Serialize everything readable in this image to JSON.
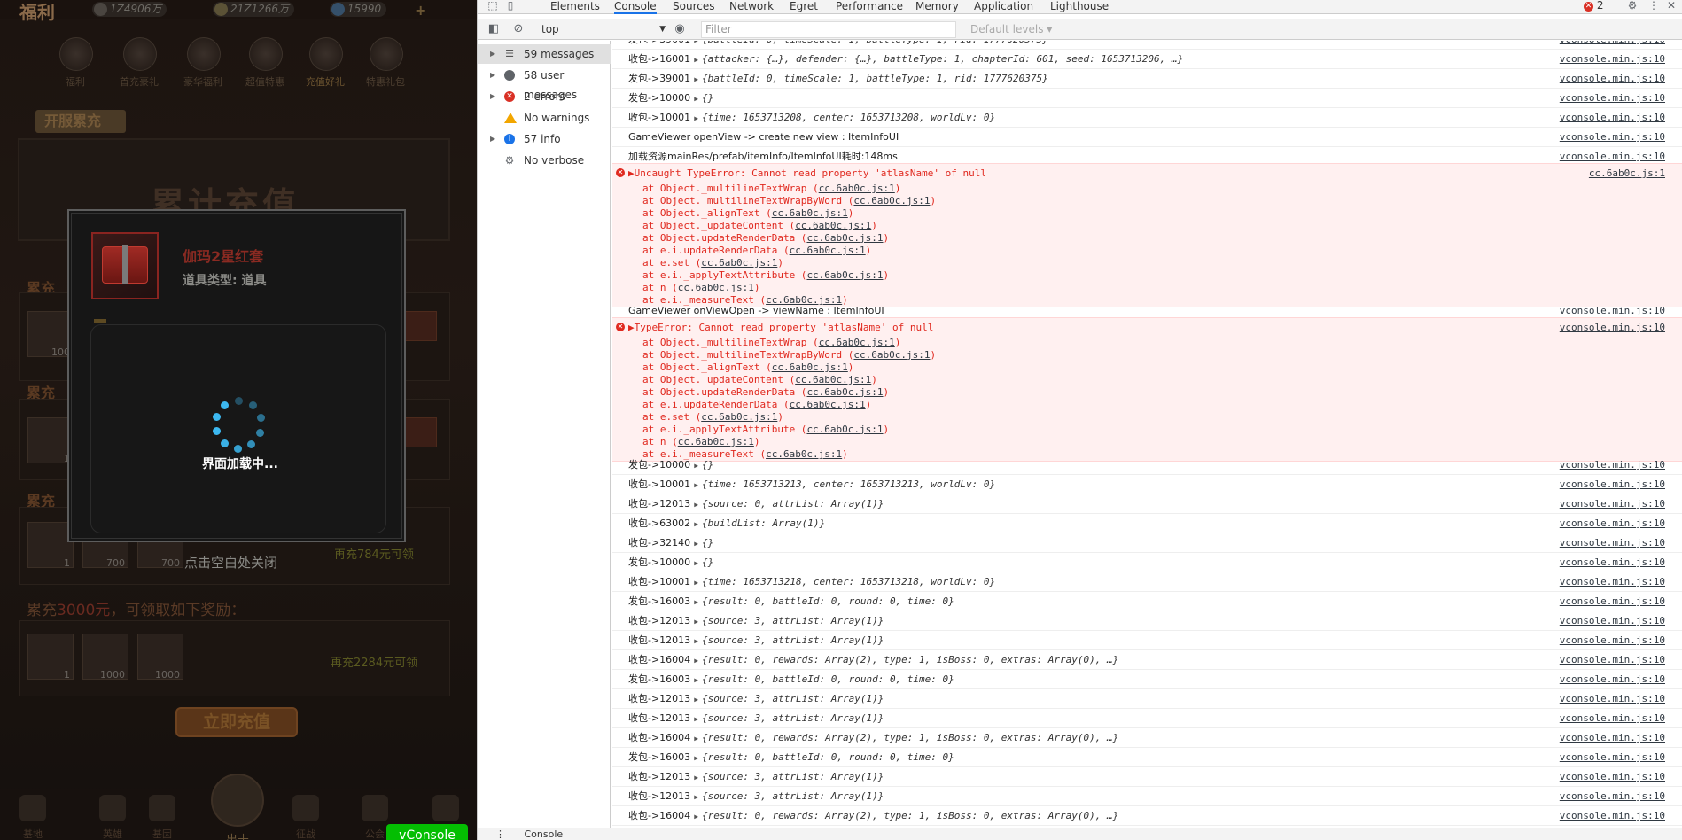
{
  "game": {
    "title": "福利",
    "resources": {
      "exp": "1Z4906万",
      "exp_label": "EXP",
      "gold": "21Z1266万",
      "gem": "15990",
      "plus": "+"
    },
    "icons": [
      {
        "label": "福利",
        "name": "welfare"
      },
      {
        "label": "首充豪礼",
        "name": "first-charge"
      },
      {
        "label": "豪华福利",
        "name": "luxury"
      },
      {
        "label": "超值特惠",
        "name": "deal"
      },
      {
        "label": "充值好礼",
        "name": "recharge-gift"
      },
      {
        "label": "特惠礼包",
        "name": "special-pack"
      }
    ],
    "banner_tag": "开服累充",
    "banner_title": "累计充值",
    "side_labels": [
      "累充",
      "累充",
      "累充",
      "累充"
    ],
    "row_text_prefix": "累充",
    "row_text_amount": "3000元",
    "row_text_suffix": "，可领取如下奖励：",
    "slot_counts": [
      "100",
      "1",
      "700",
      "700",
      "1",
      "1000",
      "1000"
    ],
    "hint_1": "再充784元可领",
    "hint_2": "再充2284元可领",
    "claim_button": "立即充值",
    "tap_close": "点击空白处关闭",
    "bottom_nav": [
      "基地",
      "英雄",
      "基因",
      "出击",
      "征战",
      "公会",
      "商城"
    ],
    "vconsole": "vConsole",
    "popup": {
      "item_name": "伽玛2星红套",
      "item_type": "道具类型:  道具",
      "loading": "界面加载中..."
    }
  },
  "devtools": {
    "tabs": [
      "Elements",
      "Console",
      "Sources",
      "Network",
      "Egret",
      "Performance",
      "Memory",
      "Application",
      "Lighthouse"
    ],
    "active_tab": "Console",
    "error_count": "2",
    "context": "top",
    "filter_placeholder": "Filter",
    "levels": "Default levels",
    "sidebar": [
      {
        "label": "59 messages",
        "icon": "list-icon",
        "kind": "list"
      },
      {
        "label": "58 user messages",
        "icon": "user-icon",
        "kind": "user"
      },
      {
        "label": "2 errors",
        "icon": "error-icon",
        "kind": "err"
      },
      {
        "label": "No warnings",
        "icon": "warning-icon",
        "kind": "warn"
      },
      {
        "label": "57 info",
        "icon": "info-icon",
        "kind": "info"
      },
      {
        "label": "No verbose",
        "icon": "verbose-icon",
        "kind": "verb"
      }
    ],
    "src_vconsole": "vconsole.min.js:10",
    "src_cc": "cc.6ab0c.js:1",
    "logs": [
      {
        "pre": "发包->39001",
        "obj": "{battleId: 0, timeScale: 1, battleType: 1, rid: 1777620375}"
      },
      {
        "pre": "收包->16001",
        "obj": "{attacker: {…}, defender: {…}, battleType: 1, chapterId: 601, seed: 1653713206, …}"
      },
      {
        "pre": "发包->39001",
        "obj": "{battleId: 0, timeScale: 1, battleType: 1, rid: 1777620375}"
      },
      {
        "pre": "发包->10000",
        "obj": "{}"
      },
      {
        "pre": "收包->10001",
        "obj": "{time: 1653713208, center: 1653713208, worldLv: 0}"
      },
      {
        "pre": "GameViewer openView -> create new view : ItemInfoUI",
        "obj": ""
      },
      {
        "pre": "加载资源mainRes/prefab/itemInfo/ItemInfoUI耗时:148ms",
        "obj": ""
      }
    ],
    "error1": {
      "head": "Uncaught TypeError: Cannot read property 'atlasName' of null",
      "src": "cc.6ab0c.js:1"
    },
    "mid_log": "GameViewer onViewOpen -> viewName : ItemInfoUI",
    "error2": {
      "head": "TypeError: Cannot read property 'atlasName' of null",
      "src": "vconsole.min.js:10"
    },
    "stack": [
      "at Object._multilineTextWrap",
      "at Object._multilineTextWrapByWord",
      "at Object._alignText",
      "at Object._updateContent",
      "at Object.updateRenderData",
      "at e.i.updateRenderData",
      "at e.set",
      "at e.i._applyTextAttribute",
      "at n",
      "at e.i._measureText"
    ],
    "logs2": [
      {
        "pre": "发包->10000",
        "obj": "{}"
      },
      {
        "pre": "收包->10001",
        "obj": "{time: 1653713213, center: 1653713213, worldLv: 0}"
      },
      {
        "pre": "收包->12013",
        "obj": "{source: 0, attrList: Array(1)}"
      },
      {
        "pre": "收包->63002",
        "obj": "{buildList: Array(1)}"
      },
      {
        "pre": "收包->32140",
        "obj": "{}"
      },
      {
        "pre": "发包->10000",
        "obj": "{}"
      },
      {
        "pre": "收包->10001",
        "obj": "{time: 1653713218, center: 1653713218, worldLv: 0}"
      },
      {
        "pre": "发包->16003",
        "obj": "{result: 0, battleId: 0, round: 0, time: 0}"
      },
      {
        "pre": "收包->12013",
        "obj": "{source: 3, attrList: Array(1)}"
      },
      {
        "pre": "收包->12013",
        "obj": "{source: 3, attrList: Array(1)}"
      },
      {
        "pre": "收包->16004",
        "obj": "{result: 0, rewards: Array(2), type: 1, isBoss: 0, extras: Array(0), …}"
      },
      {
        "pre": "发包->16003",
        "obj": "{result: 0, battleId: 0, round: 0, time: 0}"
      },
      {
        "pre": "收包->12013",
        "obj": "{source: 3, attrList: Array(1)}"
      },
      {
        "pre": "收包->12013",
        "obj": "{source: 3, attrList: Array(1)}"
      },
      {
        "pre": "收包->16004",
        "obj": "{result: 0, rewards: Array(2), type: 1, isBoss: 0, extras: Array(0), …}"
      },
      {
        "pre": "发包->16003",
        "obj": "{result: 0, battleId: 0, round: 0, time: 0}"
      },
      {
        "pre": "收包->12013",
        "obj": "{source: 3, attrList: Array(1)}"
      },
      {
        "pre": "收包->12013",
        "obj": "{source: 3, attrList: Array(1)}"
      },
      {
        "pre": "收包->16004",
        "obj": "{result: 0, rewards: Array(2), type: 1, isBoss: 0, extras: Array(0), …}"
      }
    ],
    "drawer_tab": "Console"
  }
}
